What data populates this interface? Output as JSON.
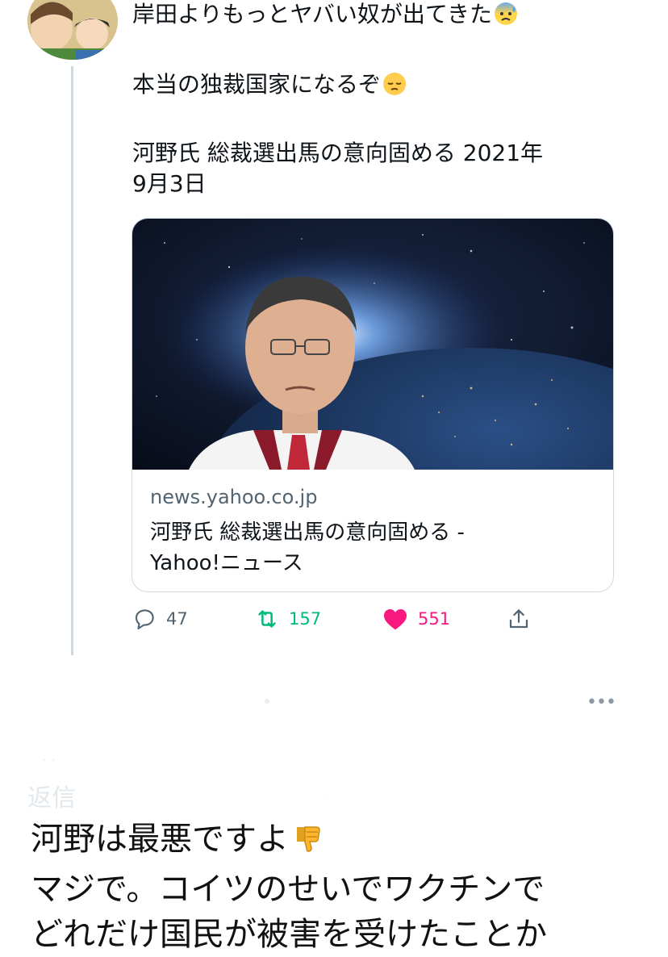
{
  "tweet": {
    "line1": "岸田よりもっとヤバい奴が出てきた",
    "line2": "本当の独裁国家になるぞ",
    "line3a": "河野氏 総裁選出馬の意向固める 2021年",
    "line3b": "9月3日",
    "emoji1": "anxious-face-with-sweat-icon",
    "emoji2": "pensive-face-icon"
  },
  "card": {
    "domain": "news.yahoo.co.jp",
    "title_line1": "河野氏 総裁選出馬の意向固める -",
    "title_line2": "Yahoo!ニュース"
  },
  "actions": {
    "reply_count": "47",
    "retweet_count": "157",
    "like_count": "551",
    "colors": {
      "retweet": "#00ba7c",
      "like": "#f91880",
      "muted": "#536471"
    }
  },
  "overlay": {
    "ghost_label": "返信",
    "line1": "河野は最悪ですよ",
    "line2": "マジで。コイツのせいでワクチンで",
    "line3": "どれだけ国民が被害を受けたことか",
    "emoji": "thumbs-down-icon"
  }
}
